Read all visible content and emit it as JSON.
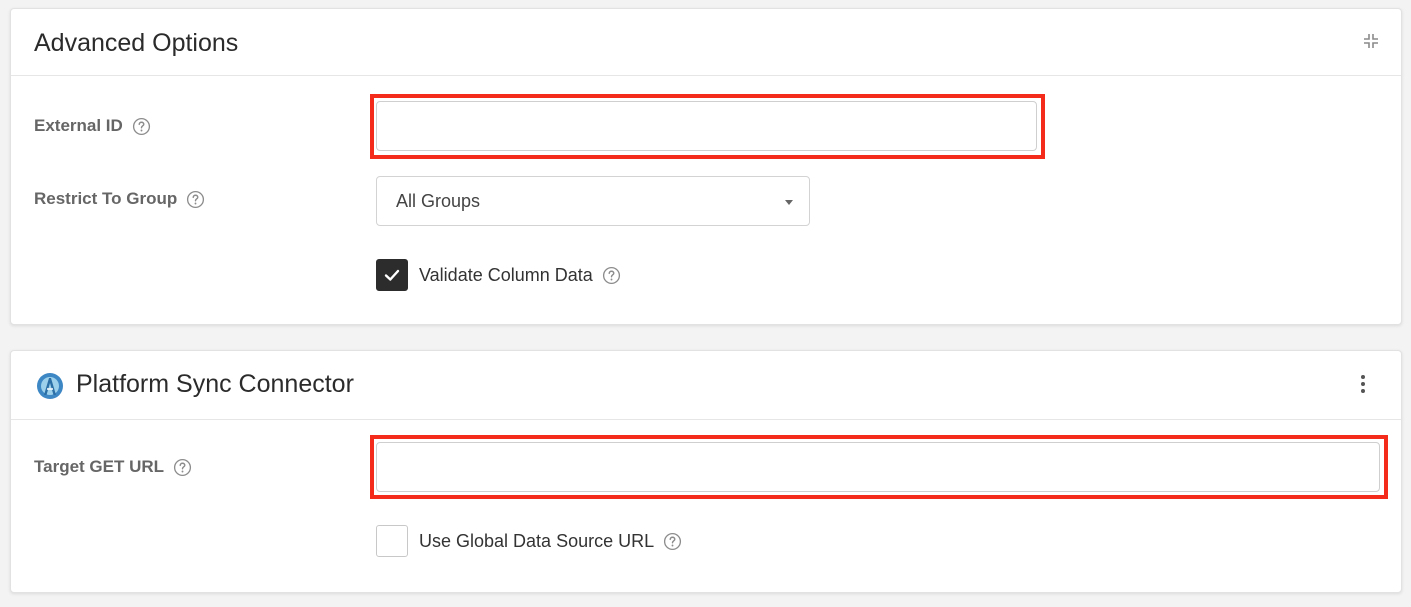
{
  "advanced_options": {
    "title": "Advanced Options",
    "collapse_icon": "collapse-icon",
    "external_id": {
      "label": "External ID",
      "value": "",
      "placeholder": "",
      "help_icon": "help-circle-icon"
    },
    "restrict_to_group": {
      "label": "Restrict To Group",
      "selected": "All Groups",
      "help_icon": "help-circle-icon"
    },
    "validate_column_data": {
      "label": "Validate Column Data",
      "checked": true,
      "help_icon": "help-circle-icon"
    }
  },
  "platform_sync": {
    "title": "Platform Sync Connector",
    "logo_icon": "connector-logo-icon",
    "menu_icon": "kebab-menu-icon",
    "target_get_url": {
      "label": "Target GET URL",
      "value": "",
      "placeholder": "",
      "help_icon": "help-circle-icon"
    },
    "use_global_url": {
      "label": "Use Global Data Source URL",
      "checked": false,
      "help_icon": "help-circle-icon"
    }
  },
  "colors": {
    "highlight": "#f42a1b",
    "checkbox_checked": "#2c2c2c",
    "label_gray": "#666666",
    "page_background": "#f3f3f3"
  }
}
